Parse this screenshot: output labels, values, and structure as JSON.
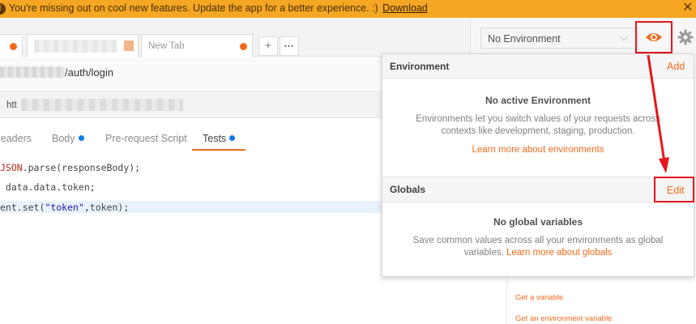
{
  "banner": {
    "message": "You're missing out on cool new features. Update the app for a better experience. :)",
    "download_link": "Download",
    "close": "✕",
    "warn_glyph": "!"
  },
  "tabs": [
    {
      "label": "",
      "dot_color": "#f26b1d"
    },
    {
      "label": "",
      "dot_color": "#f5b58a"
    },
    {
      "label": "New Tab",
      "dot_color": "#f26b1d"
    }
  ],
  "tab_actions": {
    "add": "+",
    "more": "•••"
  },
  "environment": {
    "selected": "No Environment",
    "chevron": "⌵"
  },
  "request": {
    "path": "/auth/login",
    "url_prefix": "htt"
  },
  "request_tabs": [
    {
      "label": "leaders",
      "dot": false,
      "active": false
    },
    {
      "label": "Body",
      "dot": true,
      "active": false
    },
    {
      "label": "Pre-request Script",
      "dot": false,
      "active": false
    },
    {
      "label": "Tests",
      "dot": true,
      "active": true
    }
  ],
  "code": {
    "line1_kw": "JSON",
    "line1_rest": ".parse(responseBody);",
    "line2": " data.data.token;",
    "line3_pre": "ent.set(",
    "line3_str": "\"token\"",
    "line3_post": ",token);"
  },
  "popover": {
    "environment_title": "Environment",
    "environment_action": "Add",
    "no_env_heading": "No active Environment",
    "no_env_text": "Environments let you switch values of your requests across contexts like development, staging, production.",
    "no_env_link": "Learn more about environments",
    "globals_title": "Globals",
    "globals_action": "Edit",
    "no_globals_heading": "No global variables",
    "no_globals_text": "Save common values across all your environments as global variables.",
    "no_globals_link": "Learn more about globals"
  },
  "snippets": [
    "Get a variable",
    "Get an environment variable"
  ],
  "colors": {
    "accent": "#f26b1d",
    "banner": "#f5a623",
    "annotation": "#e5171b",
    "tab_dot_blue": "#097bed"
  },
  "icons": {
    "quick_look": "eye-icon",
    "settings": "gear-icon",
    "close": "close-icon"
  }
}
